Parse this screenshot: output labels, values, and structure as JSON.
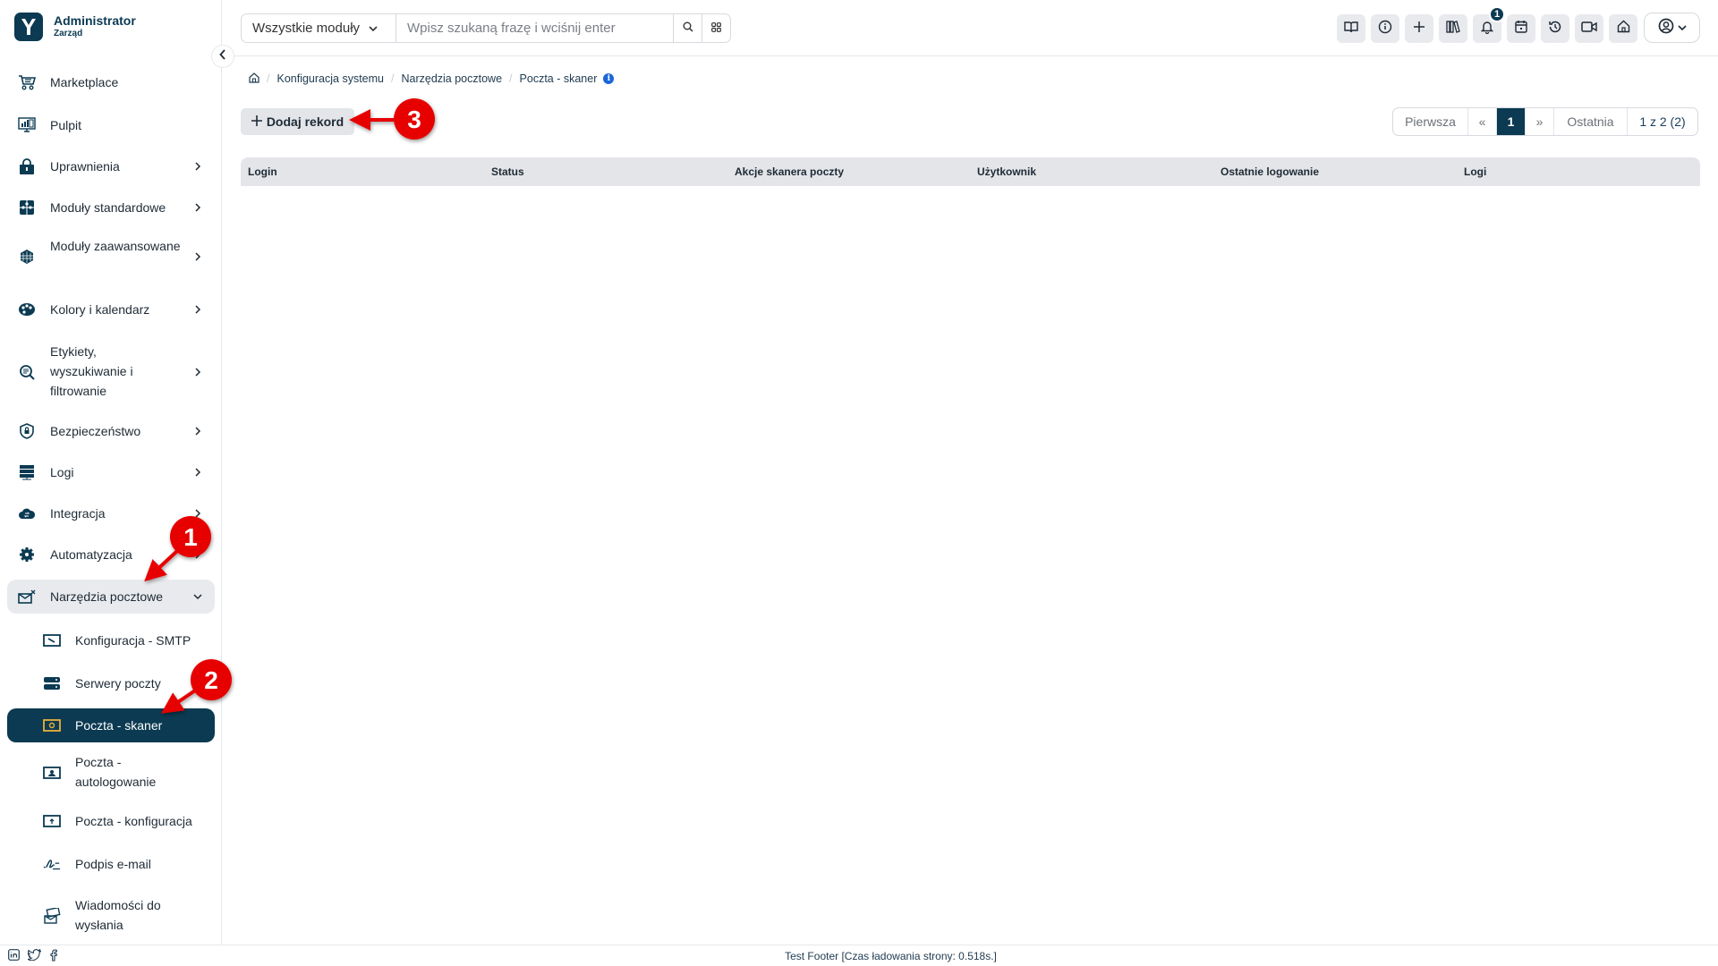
{
  "brand": {
    "name": "Administrator",
    "subtitle": "Zarząd"
  },
  "sidebar": {
    "items": [
      {
        "label": "Marketplace",
        "icon": "cart-icon",
        "has_children": false
      },
      {
        "label": "Pulpit",
        "icon": "dashboard-icon",
        "has_children": false
      },
      {
        "label": "Uprawnienia",
        "icon": "lock-icon",
        "has_children": true
      },
      {
        "label": "Moduły standardowe",
        "icon": "puzzle-icon",
        "has_children": true
      },
      {
        "label": "Moduły zaawansowane",
        "icon": "cube-icon",
        "has_children": true
      },
      {
        "label": "Kolory i kalendarz",
        "icon": "palette-icon",
        "has_children": true
      },
      {
        "label": "Etykiety, wyszukiwanie i filtrowanie",
        "icon": "search-tag-icon",
        "has_children": true
      },
      {
        "label": "Bezpieczeństwo",
        "icon": "shield-icon",
        "has_children": true
      },
      {
        "label": "Logi",
        "icon": "server-log-icon",
        "has_children": true
      },
      {
        "label": "Integracja",
        "icon": "cloud-icon",
        "has_children": true
      },
      {
        "label": "Automatyzacja",
        "icon": "gear-icon",
        "has_children": true
      },
      {
        "label": "Narzędzia pocztowe",
        "icon": "mail-tools-icon",
        "has_children": true,
        "expanded": true
      }
    ],
    "sub_items": [
      {
        "label": "Konfiguracja - SMTP",
        "icon": "smtp-icon"
      },
      {
        "label": "Serwery poczty",
        "icon": "servers-icon"
      },
      {
        "label": "Poczta - skaner",
        "icon": "scanner-icon",
        "active": true
      },
      {
        "label": "Poczta - autologowanie",
        "icon": "autologin-icon"
      },
      {
        "label": "Poczta - konfiguracja",
        "icon": "mail-config-icon"
      },
      {
        "label": "Podpis e-mail",
        "icon": "signature-icon"
      },
      {
        "label": "Wiadomości do wysłania",
        "icon": "outbox-icon"
      }
    ]
  },
  "topbar": {
    "module_select": "Wszystkie moduły",
    "search_placeholder": "Wpisz szukaną frazę i wciśnij enter",
    "search_value": "",
    "tools": [
      {
        "name": "knowledge-base",
        "icon": "book-icon"
      },
      {
        "name": "info",
        "icon": "info-icon"
      },
      {
        "name": "quick-create",
        "icon": "plus-icon"
      },
      {
        "name": "library",
        "icon": "books-icon"
      },
      {
        "name": "notifications",
        "icon": "bell-icon",
        "badge": "1"
      },
      {
        "name": "calendar",
        "icon": "calendar-icon"
      },
      {
        "name": "history",
        "icon": "history-icon"
      },
      {
        "name": "video",
        "icon": "video-icon"
      },
      {
        "name": "home",
        "icon": "home-icon"
      }
    ]
  },
  "breadcrumb": [
    "Konfiguracja systemu",
    "Narzędzia pocztowe",
    "Poczta - skaner"
  ],
  "actions": {
    "add_record": "Dodaj rekord"
  },
  "pagination": {
    "first": "Pierwsza",
    "prev": "«",
    "current": "1",
    "next": "»",
    "last": "Ostatnia",
    "summary": "1 z 2 (2)"
  },
  "table": {
    "columns": [
      "Login",
      "Status",
      "Akcje skanera poczty",
      "Użytkownik",
      "Ostatnie logowanie",
      "Logi"
    ],
    "rows": []
  },
  "footer": {
    "text": "Test Footer [Czas ładowania strony: 0.518s.]"
  },
  "annotations": [
    {
      "label": "1"
    },
    {
      "label": "2"
    },
    {
      "label": "3"
    }
  ],
  "colors": {
    "primary": "#0b3a52",
    "annotation": "#e60000",
    "info": "#1a66d9"
  }
}
